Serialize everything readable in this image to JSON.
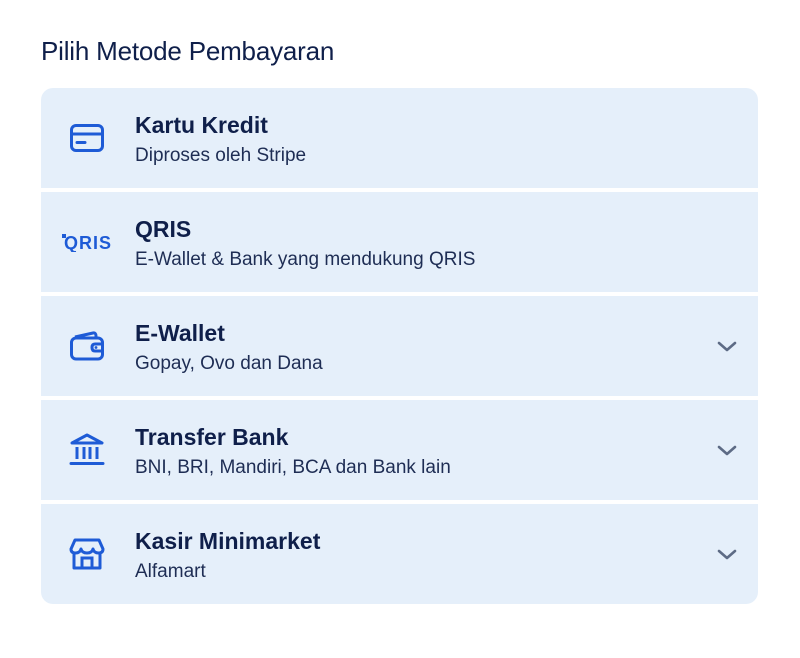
{
  "page": {
    "title": "Pilih Metode Pembayaran"
  },
  "colors": {
    "card_bg": "#e5effa",
    "icon_blue": "#1e5bd6",
    "text_dark": "#0f1f4a",
    "chevron": "#5d6b85"
  },
  "methods": [
    {
      "name": "Kartu Kredit",
      "desc": "Diproses oleh Stripe",
      "icon": "credit-card-icon",
      "expandable": false
    },
    {
      "name": "QRIS",
      "desc": "E-Wallet & Bank yang mendukung QRIS",
      "icon": "qris-logo-icon",
      "logo_text": "QRIS",
      "expandable": false
    },
    {
      "name": "E-Wallet",
      "desc": "Gopay, Ovo dan Dana",
      "icon": "wallet-icon",
      "expandable": true
    },
    {
      "name": "Transfer Bank",
      "desc": "BNI, BRI, Mandiri, BCA dan Bank lain",
      "icon": "bank-icon",
      "expandable": true
    },
    {
      "name": "Kasir Minimarket",
      "desc": "Alfamart",
      "icon": "store-icon",
      "expandable": true
    }
  ]
}
